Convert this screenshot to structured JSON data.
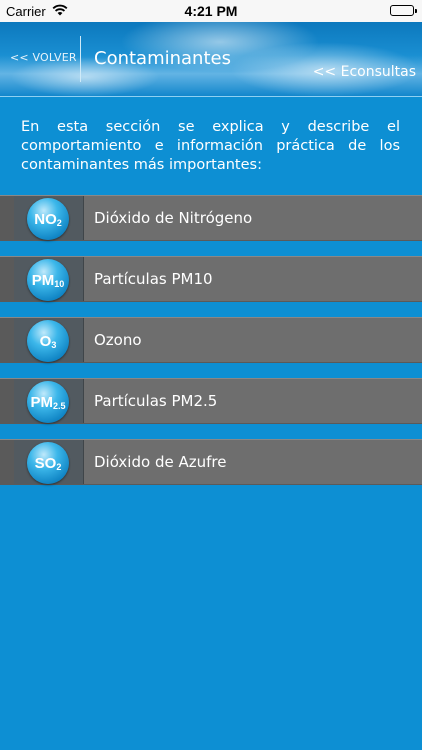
{
  "status_bar": {
    "carrier": "Carrier",
    "time": "4:21 PM"
  },
  "header": {
    "back_label": "<< VOLVER",
    "title": "Contaminantes",
    "link_label": "<< Econsultas"
  },
  "intro_text": "En esta sección se explica y describe el comportamiento e información práctica de los contaminantes más importantes:",
  "pollutants": [
    {
      "symbol": "NO",
      "subscript": "2",
      "label": "Dióxido de Nitrógeno"
    },
    {
      "symbol": "PM",
      "subscript": "10",
      "label": "Partículas PM10"
    },
    {
      "symbol": "O",
      "subscript": "3",
      "label": "Ozono"
    },
    {
      "symbol": "PM",
      "subscript": "2.5",
      "label": "Partículas PM2.5"
    },
    {
      "symbol": "SO",
      "subscript": "2",
      "label": "Dióxido de Azufre"
    }
  ],
  "colors": {
    "background": "#0d8fd3",
    "row": "#6e6e6e",
    "icon": "#1a9ad8"
  }
}
